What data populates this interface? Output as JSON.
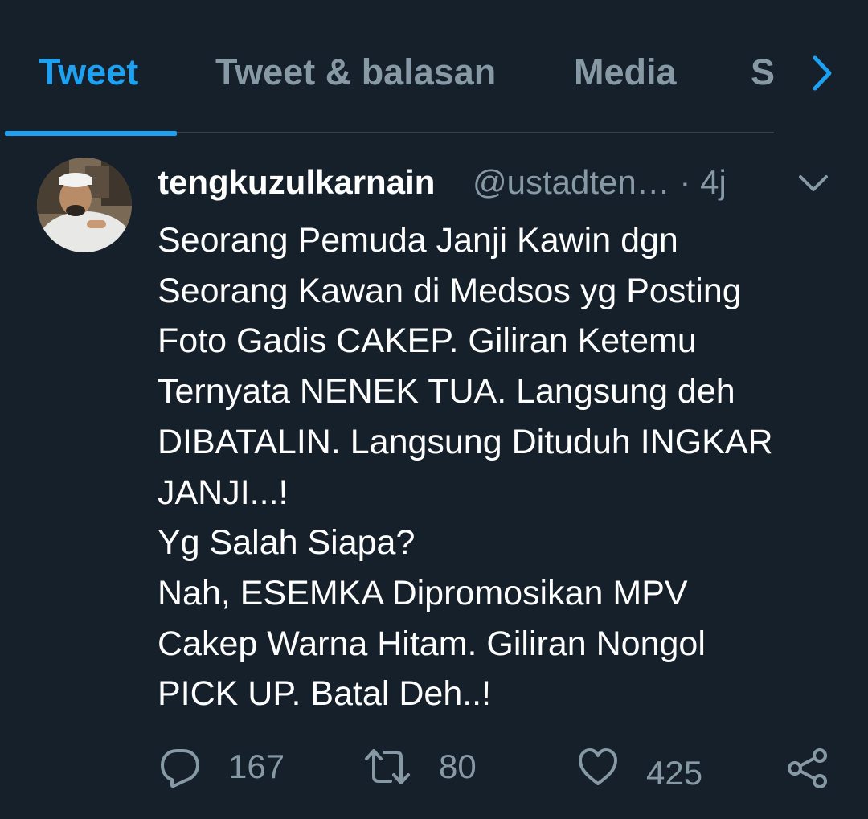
{
  "tabs": [
    {
      "label": "Tweet",
      "active": true
    },
    {
      "label": "Tweet & balasan",
      "active": false
    },
    {
      "label": "Media",
      "active": false
    },
    {
      "label": "S",
      "active": false
    }
  ],
  "tweet": {
    "username": "tengkuzulkarnain",
    "handle": "@ustadten… · 4j",
    "text": "Seorang Pemuda Janji Kawin dgn\nSeorang Kawan di Medsos yg Posting\nFoto Gadis CAKEP. Giliran Ketemu\nTernyata NENEK TUA. Langsung deh\nDIBATALIN. Langsung Dituduh INGKAR\nJANJI...!\nYg Salah Siapa?\nNah, ESEMKA Dipromosikan MPV\nCakep Warna Hitam. Giliran Nongol\nPICK UP. Batal Deh..!",
    "replies": "167",
    "retweets": "80",
    "likes": "425"
  },
  "colors": {
    "background": "#15202b",
    "accent": "#1da1f2",
    "muted": "#8899a6",
    "divider": "#38444d"
  },
  "icons": [
    "chevron-right-icon",
    "caret-down-icon",
    "reply-icon",
    "retweet-icon",
    "like-icon",
    "share-icon"
  ]
}
